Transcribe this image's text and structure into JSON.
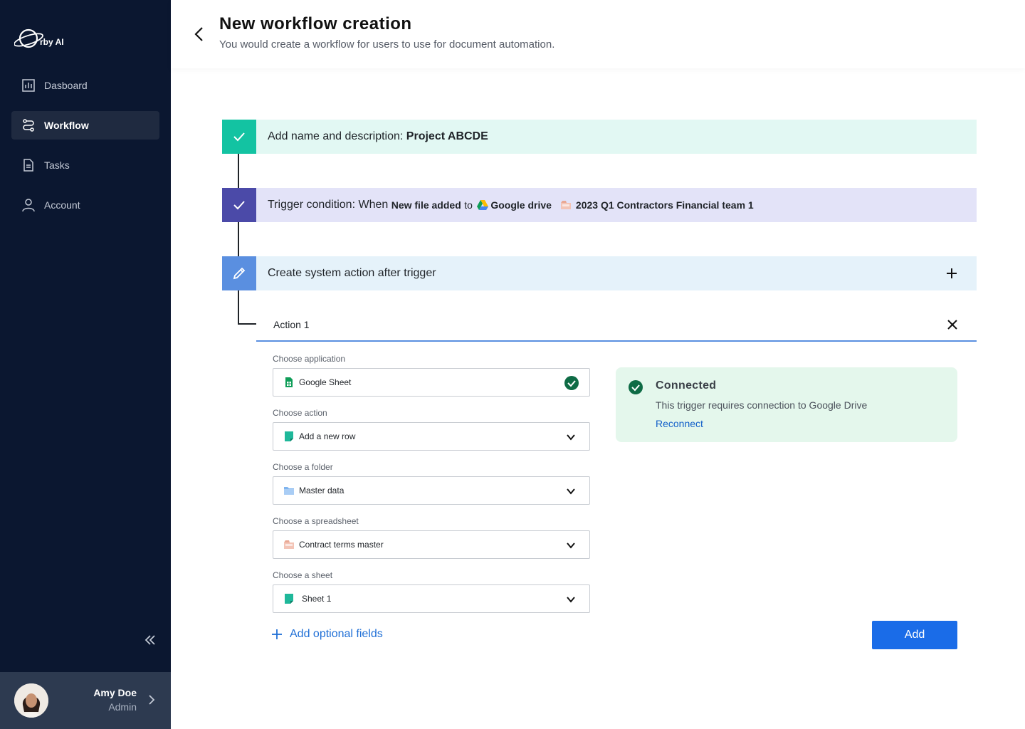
{
  "brand": {
    "name": "rby AI"
  },
  "sidebar": {
    "items": [
      {
        "label": "Dasboard",
        "icon": "chart-icon",
        "active": false
      },
      {
        "label": "Workflow",
        "icon": "workflow-icon",
        "active": true
      },
      {
        "label": "Tasks",
        "icon": "document-icon",
        "active": false
      },
      {
        "label": "Account",
        "icon": "user-icon",
        "active": false
      }
    ],
    "user": {
      "name": "Amy Doe",
      "role": "Admin"
    }
  },
  "header": {
    "title": "New workflow creation",
    "subtitle": "You would create a workflow for users to use for document automation."
  },
  "steps": {
    "step1": {
      "prefix": "Add name and description:",
      "value": "Project ABCDE"
    },
    "step2": {
      "prefix": "Trigger condition: When",
      "event": "New file added",
      "to": "to",
      "service": "Google drive",
      "folder": "2023 Q1 Contractors Financial team 1"
    },
    "step3": {
      "label": "Create system action after trigger"
    }
  },
  "action": {
    "title": "Action 1",
    "fields": [
      {
        "label": "Choose application",
        "value": "Google Sheet",
        "icon": "google-sheet-icon"
      },
      {
        "label": "Choose action",
        "value": "Add a new row",
        "icon": "row-icon"
      },
      {
        "label": "Choose a folder",
        "value": "Master data",
        "icon": "folder-icon"
      },
      {
        "label": "Choose a spreadsheet",
        "value": "Contract terms master",
        "icon": "spreadsheet-icon"
      },
      {
        "label": "Choose a sheet",
        "value": "Sheet 1",
        "icon": "sheet-icon"
      }
    ],
    "optional_label": "Add optional fields",
    "add_label": "Add"
  },
  "connection": {
    "title": "Connected",
    "text": "This trigger requires connection to Google Drive",
    "link": "Reconnect"
  },
  "colors": {
    "sidebar_bg": "#0b1730",
    "step1_accent": "#13c3a2",
    "step2_accent": "#4b4aa8",
    "step3_accent": "#5a8fe0",
    "primary": "#1a6ce8",
    "success": "#0e6b45"
  }
}
